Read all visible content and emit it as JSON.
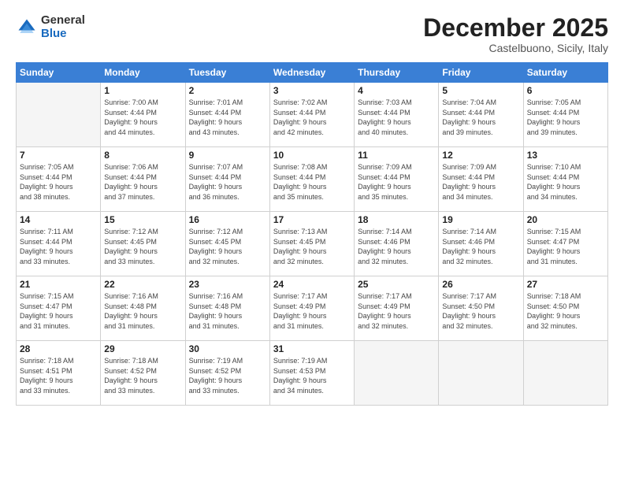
{
  "logo": {
    "general": "General",
    "blue": "Blue"
  },
  "header": {
    "month": "December 2025",
    "location": "Castelbuono, Sicily, Italy"
  },
  "weekdays": [
    "Sunday",
    "Monday",
    "Tuesday",
    "Wednesday",
    "Thursday",
    "Friday",
    "Saturday"
  ],
  "weeks": [
    [
      {
        "day": "",
        "info": ""
      },
      {
        "day": "1",
        "info": "Sunrise: 7:00 AM\nSunset: 4:44 PM\nDaylight: 9 hours\nand 44 minutes."
      },
      {
        "day": "2",
        "info": "Sunrise: 7:01 AM\nSunset: 4:44 PM\nDaylight: 9 hours\nand 43 minutes."
      },
      {
        "day": "3",
        "info": "Sunrise: 7:02 AM\nSunset: 4:44 PM\nDaylight: 9 hours\nand 42 minutes."
      },
      {
        "day": "4",
        "info": "Sunrise: 7:03 AM\nSunset: 4:44 PM\nDaylight: 9 hours\nand 40 minutes."
      },
      {
        "day": "5",
        "info": "Sunrise: 7:04 AM\nSunset: 4:44 PM\nDaylight: 9 hours\nand 39 minutes."
      },
      {
        "day": "6",
        "info": "Sunrise: 7:05 AM\nSunset: 4:44 PM\nDaylight: 9 hours\nand 39 minutes."
      }
    ],
    [
      {
        "day": "7",
        "info": "Sunrise: 7:05 AM\nSunset: 4:44 PM\nDaylight: 9 hours\nand 38 minutes."
      },
      {
        "day": "8",
        "info": "Sunrise: 7:06 AM\nSunset: 4:44 PM\nDaylight: 9 hours\nand 37 minutes."
      },
      {
        "day": "9",
        "info": "Sunrise: 7:07 AM\nSunset: 4:44 PM\nDaylight: 9 hours\nand 36 minutes."
      },
      {
        "day": "10",
        "info": "Sunrise: 7:08 AM\nSunset: 4:44 PM\nDaylight: 9 hours\nand 35 minutes."
      },
      {
        "day": "11",
        "info": "Sunrise: 7:09 AM\nSunset: 4:44 PM\nDaylight: 9 hours\nand 35 minutes."
      },
      {
        "day": "12",
        "info": "Sunrise: 7:09 AM\nSunset: 4:44 PM\nDaylight: 9 hours\nand 34 minutes."
      },
      {
        "day": "13",
        "info": "Sunrise: 7:10 AM\nSunset: 4:44 PM\nDaylight: 9 hours\nand 34 minutes."
      }
    ],
    [
      {
        "day": "14",
        "info": "Sunrise: 7:11 AM\nSunset: 4:44 PM\nDaylight: 9 hours\nand 33 minutes."
      },
      {
        "day": "15",
        "info": "Sunrise: 7:12 AM\nSunset: 4:45 PM\nDaylight: 9 hours\nand 33 minutes."
      },
      {
        "day": "16",
        "info": "Sunrise: 7:12 AM\nSunset: 4:45 PM\nDaylight: 9 hours\nand 32 minutes."
      },
      {
        "day": "17",
        "info": "Sunrise: 7:13 AM\nSunset: 4:45 PM\nDaylight: 9 hours\nand 32 minutes."
      },
      {
        "day": "18",
        "info": "Sunrise: 7:14 AM\nSunset: 4:46 PM\nDaylight: 9 hours\nand 32 minutes."
      },
      {
        "day": "19",
        "info": "Sunrise: 7:14 AM\nSunset: 4:46 PM\nDaylight: 9 hours\nand 32 minutes."
      },
      {
        "day": "20",
        "info": "Sunrise: 7:15 AM\nSunset: 4:47 PM\nDaylight: 9 hours\nand 31 minutes."
      }
    ],
    [
      {
        "day": "21",
        "info": "Sunrise: 7:15 AM\nSunset: 4:47 PM\nDaylight: 9 hours\nand 31 minutes."
      },
      {
        "day": "22",
        "info": "Sunrise: 7:16 AM\nSunset: 4:48 PM\nDaylight: 9 hours\nand 31 minutes."
      },
      {
        "day": "23",
        "info": "Sunrise: 7:16 AM\nSunset: 4:48 PM\nDaylight: 9 hours\nand 31 minutes."
      },
      {
        "day": "24",
        "info": "Sunrise: 7:17 AM\nSunset: 4:49 PM\nDaylight: 9 hours\nand 31 minutes."
      },
      {
        "day": "25",
        "info": "Sunrise: 7:17 AM\nSunset: 4:49 PM\nDaylight: 9 hours\nand 32 minutes."
      },
      {
        "day": "26",
        "info": "Sunrise: 7:17 AM\nSunset: 4:50 PM\nDaylight: 9 hours\nand 32 minutes."
      },
      {
        "day": "27",
        "info": "Sunrise: 7:18 AM\nSunset: 4:50 PM\nDaylight: 9 hours\nand 32 minutes."
      }
    ],
    [
      {
        "day": "28",
        "info": "Sunrise: 7:18 AM\nSunset: 4:51 PM\nDaylight: 9 hours\nand 33 minutes."
      },
      {
        "day": "29",
        "info": "Sunrise: 7:18 AM\nSunset: 4:52 PM\nDaylight: 9 hours\nand 33 minutes."
      },
      {
        "day": "30",
        "info": "Sunrise: 7:19 AM\nSunset: 4:52 PM\nDaylight: 9 hours\nand 33 minutes."
      },
      {
        "day": "31",
        "info": "Sunrise: 7:19 AM\nSunset: 4:53 PM\nDaylight: 9 hours\nand 34 minutes."
      },
      {
        "day": "",
        "info": ""
      },
      {
        "day": "",
        "info": ""
      },
      {
        "day": "",
        "info": ""
      }
    ]
  ]
}
